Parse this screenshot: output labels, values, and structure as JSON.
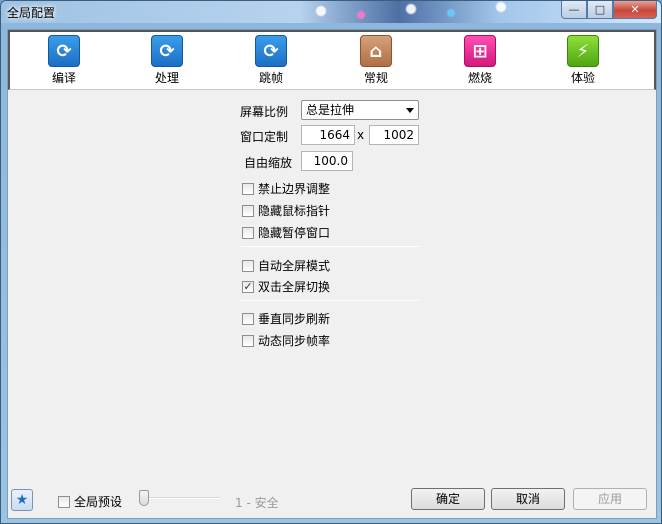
{
  "window": {
    "title": "全局配置",
    "min_icon": "minimize-icon",
    "max_icon": "maximize-icon",
    "close_icon": "close-icon"
  },
  "toolbar": {
    "items": [
      {
        "label": "编译",
        "icon": "refresh-icon",
        "color": "#1c6fc4"
      },
      {
        "label": "处理",
        "icon": "refresh-icon",
        "color": "#1c6fc4"
      },
      {
        "label": "跳帧",
        "icon": "refresh-icon",
        "color": "#1c6fc4"
      },
      {
        "label": "常规",
        "icon": "home-icon",
        "color": "#b07042"
      },
      {
        "label": "燃烧",
        "icon": "windows-icon",
        "color": "#d4177f"
      },
      {
        "label": "体验",
        "icon": "lightning-icon",
        "color": "#4ea510"
      }
    ]
  },
  "settings": {
    "screen_ratio_label": "屏幕比例",
    "screen_ratio_value": "总是拉伸",
    "window_custom_label": "窗口定制",
    "window_width": "1664",
    "window_x": "x",
    "window_height": "1002",
    "free_zoom_label": "自由缩放",
    "free_zoom_value": "100.0"
  },
  "checks": [
    {
      "label": "禁止边界调整",
      "checked": false
    },
    {
      "label": "隐藏鼠标指针",
      "checked": false
    },
    {
      "label": "隐藏暂停窗口",
      "checked": false
    },
    {
      "label": "自动全屏模式",
      "checked": false
    },
    {
      "label": "双击全屏切换",
      "checked": true
    },
    {
      "label": "垂直同步刷新",
      "checked": false
    },
    {
      "label": "动态同步帧率",
      "checked": false
    }
  ],
  "footer": {
    "star_icon": "star-icon",
    "global_preset_label": "全局预设",
    "global_preset_checked": false,
    "slider_label": "1 - 安全",
    "ok_label": "确定",
    "cancel_label": "取消",
    "apply_label": "应用"
  }
}
